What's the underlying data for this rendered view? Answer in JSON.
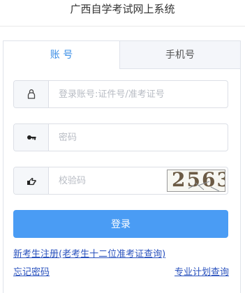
{
  "header": {
    "title": "广西自学考试网上系统"
  },
  "tabs": [
    {
      "label": "账 号",
      "active": true
    },
    {
      "label": "手机号",
      "active": false
    }
  ],
  "form": {
    "username_placeholder": "登录账号:证件号/准考证号",
    "password_placeholder": "密码",
    "captcha_placeholder": "校验码",
    "captcha_text": "2563",
    "login_label": "登录"
  },
  "links": {
    "register": "新考生注册(老考生十二位准考证查询)",
    "forgot_password": "忘记密码",
    "plan_query": "专业计划查询"
  },
  "colors": {
    "accent": "#4a9cf4",
    "active_tab_text": "#3a8ee6",
    "link": "#2a52be"
  },
  "icons": {
    "username": "user-icon",
    "password": "key-icon",
    "captcha": "hand-pointer-icon"
  }
}
